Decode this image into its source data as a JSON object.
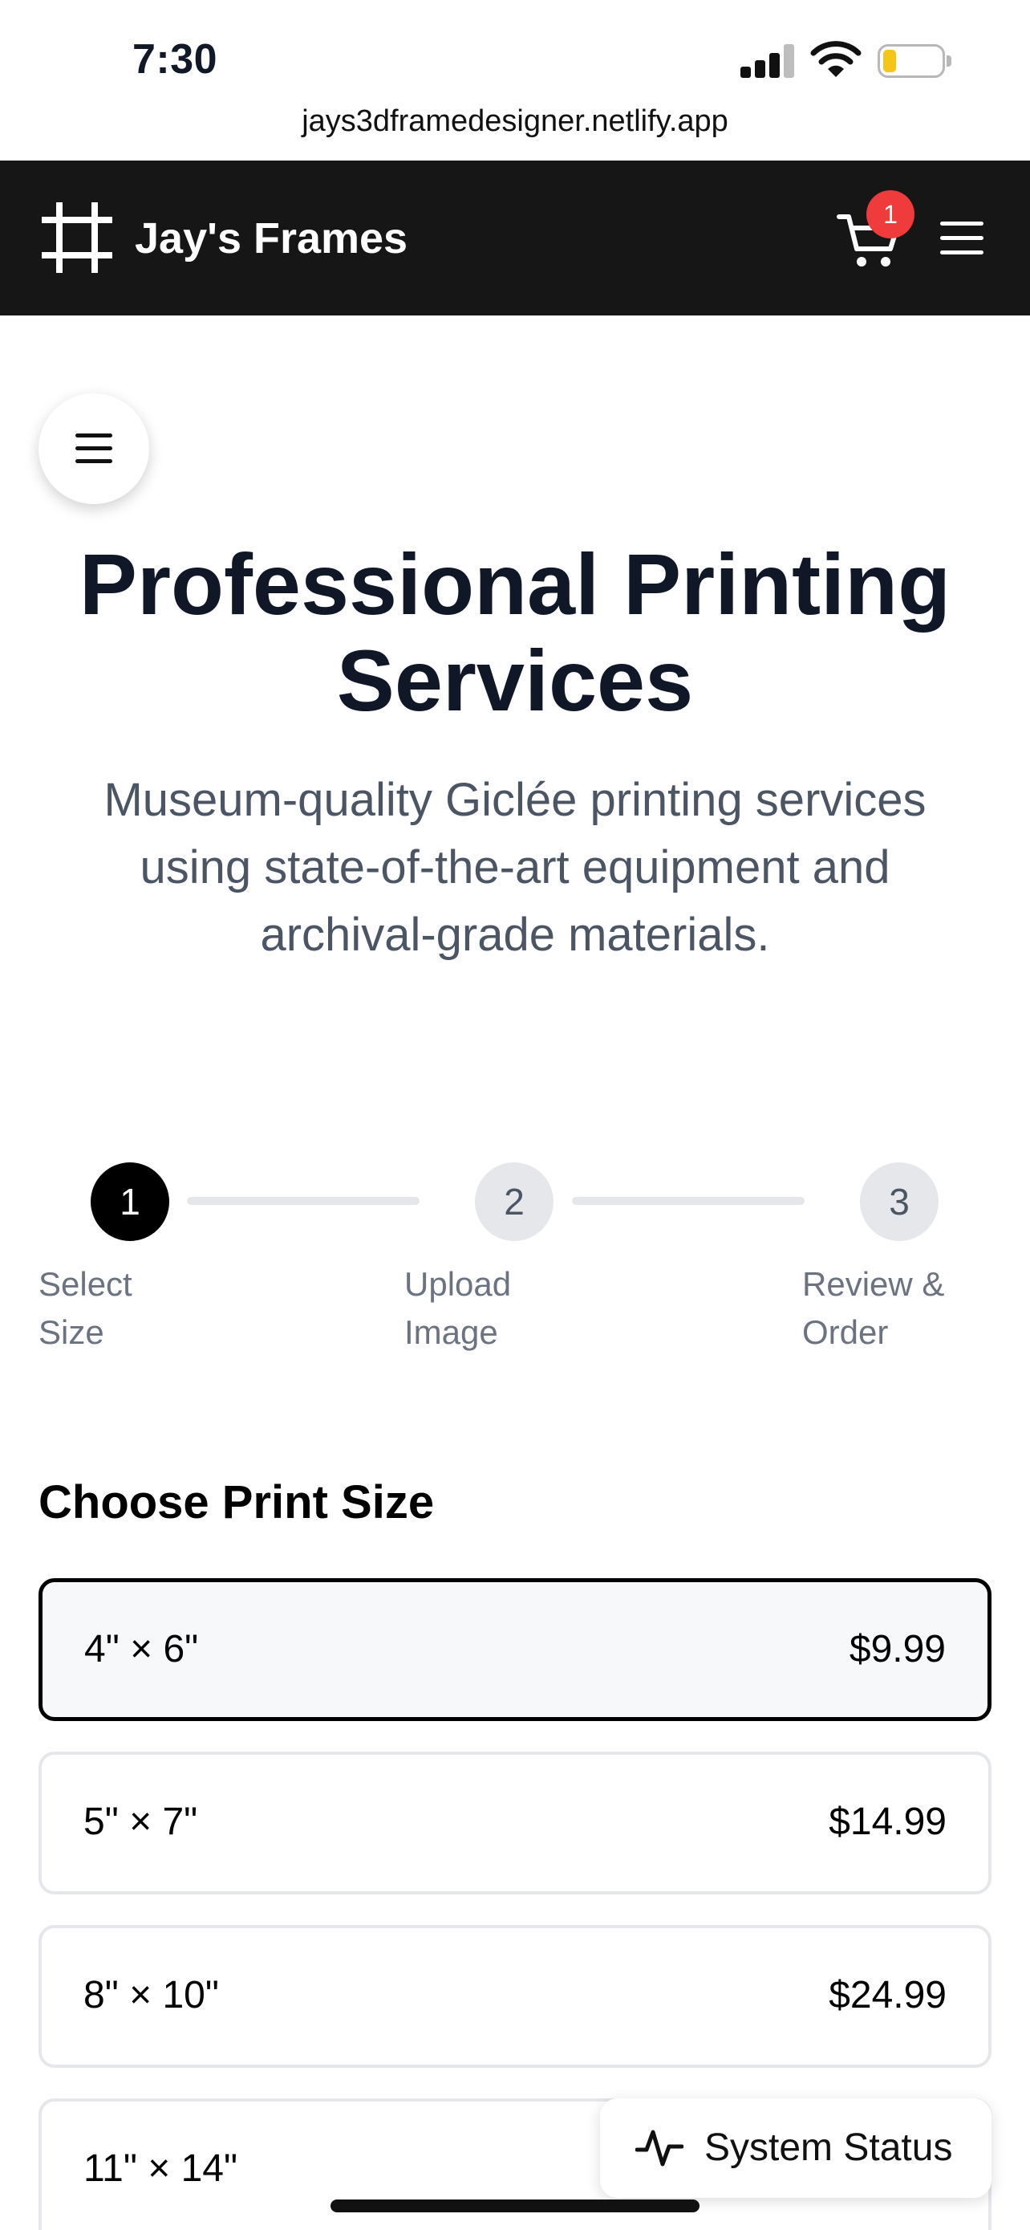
{
  "status_bar": {
    "time": "7:30"
  },
  "browser": {
    "url": "jays3dframedesigner.netlify.app"
  },
  "header": {
    "brand": "Jay's Frames",
    "cart_count": "1"
  },
  "hero": {
    "title": "Professional Printing Services",
    "subtitle": "Museum-quality Giclée printing services using state-of-the-art equipment and archival-grade materials."
  },
  "stepper": {
    "steps": [
      {
        "number": "1",
        "label_line1": "Select",
        "label_line2": "Size"
      },
      {
        "number": "2",
        "label_line1": "Upload",
        "label_line2": "Image"
      },
      {
        "number": "3",
        "label_line1": "Review &",
        "label_line2": "Order"
      }
    ]
  },
  "sizes": {
    "title": "Choose Print Size",
    "options": [
      {
        "label": "4\" × 6\"",
        "price": "$9.99"
      },
      {
        "label": "5\" × 7\"",
        "price": "$14.99"
      },
      {
        "label": "8\" × 10\"",
        "price": "$24.99"
      },
      {
        "label": "11\" × 14\"",
        "price": ""
      }
    ]
  },
  "system_status": {
    "label": "System Status"
  },
  "colors": {
    "header_bg": "#161616",
    "badge": "#ef3b3b",
    "battery": "#f5c518"
  }
}
